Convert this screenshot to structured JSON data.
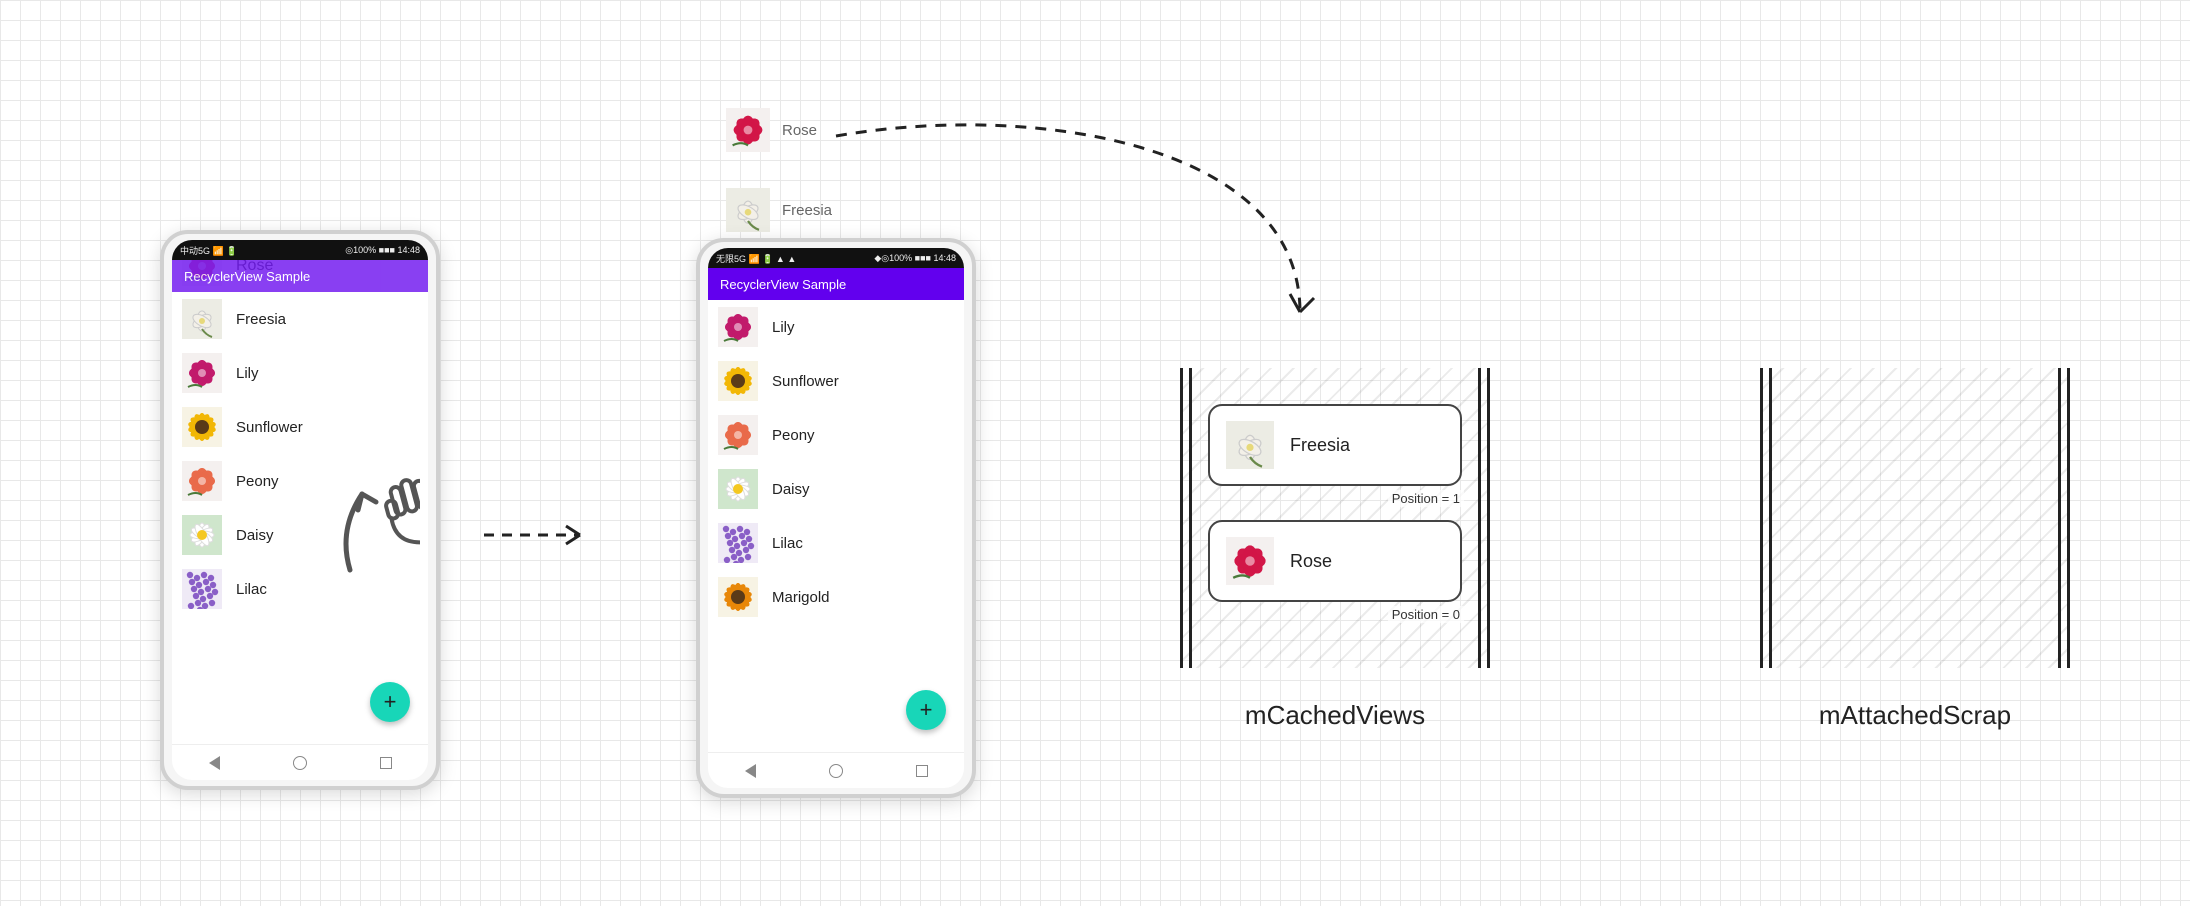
{
  "phone1": {
    "status_left": "中动5G 📶 🔋",
    "status_right": "◎100% ■■■ 14:48",
    "app_title": "RecyclerView Sample",
    "overflow_row": "Rose",
    "items": [
      "Freesia",
      "Lily",
      "Sunflower",
      "Peony",
      "Daisy",
      "Lilac"
    ],
    "fab": "+"
  },
  "phone2": {
    "status_left": "无限5G 📶 🔋 ▲ ▲",
    "status_right": "◆◎100% ■■■ 14:48",
    "app_title": "RecyclerView Sample",
    "items": [
      "Lily",
      "Sunflower",
      "Peony",
      "Daisy",
      "Lilac",
      "Marigold"
    ],
    "fab": "+"
  },
  "float_rows": {
    "row0": "Rose",
    "row1": "Freesia"
  },
  "cached": {
    "label": "mCachedViews",
    "item0": {
      "label": "Freesia",
      "position_tag": "Position = 1"
    },
    "item1": {
      "label": "Rose",
      "position_tag": "Position = 0"
    }
  },
  "scrap": {
    "label": "mAttachedScrap"
  },
  "flower_colors": {
    "Rose": "#d11648",
    "Freesia": "#f3f0e8",
    "Lily": "#c11a6b",
    "Sunflower": "#f2b705",
    "Peony": "#e86a4a",
    "Daisy": "#ffffff",
    "Lilac": "#8a5fc7",
    "Marigold": "#e88708"
  }
}
